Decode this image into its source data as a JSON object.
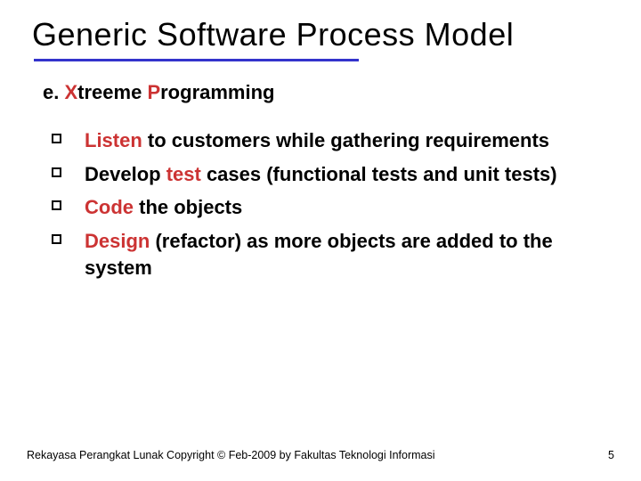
{
  "title": "Generic Software Process Model",
  "subtitle": {
    "part1": "e. ",
    "accent1": "X",
    "part2": "treeme ",
    "accent2": "P",
    "part3": "rogramming"
  },
  "bullets": [
    {
      "accent": "Listen",
      "rest": " to customers while gathering requirements"
    },
    {
      "pre": "Develop ",
      "accent": "test",
      "rest": " cases (functional tests and unit tests)"
    },
    {
      "accent": "Code",
      "rest": " the objects"
    },
    {
      "accent": "Design",
      "rest": " (refactor) as more objects are added to the system"
    }
  ],
  "footer": {
    "left": "Rekayasa Perangkat Lunak Copyright © Feb-2009 by Fakultas Teknologi Informasi",
    "right": "5"
  }
}
